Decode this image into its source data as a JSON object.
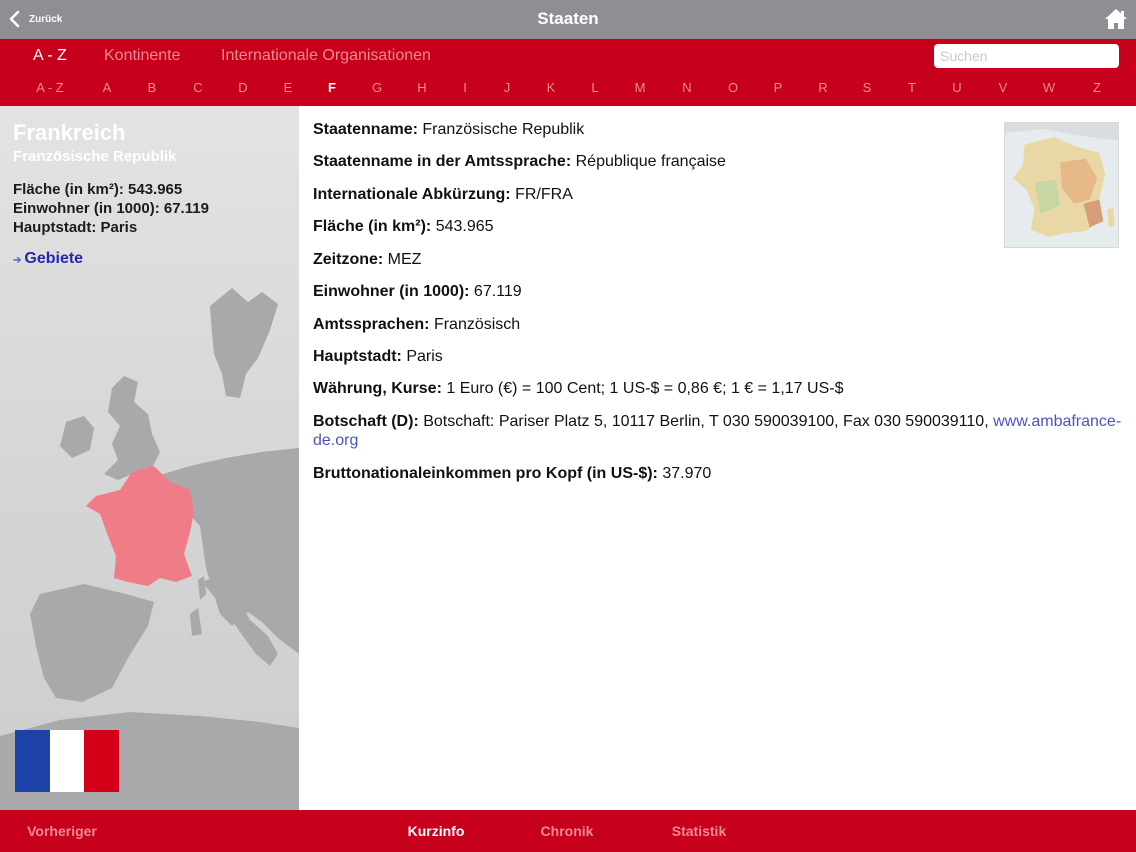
{
  "titlebar": {
    "back_label": "Zurück",
    "title": "Staaten"
  },
  "nav": {
    "segments": [
      "A - Z",
      "Kontinente",
      "Internationale Organisationen"
    ],
    "active_segment": "A - Z",
    "search_placeholder": "Suchen",
    "letters": [
      "A - Z",
      "A",
      "B",
      "C",
      "D",
      "E",
      "F",
      "G",
      "H",
      "I",
      "J",
      "K",
      "L",
      "M",
      "N",
      "O",
      "P",
      "R",
      "S",
      "T",
      "U",
      "V",
      "W",
      "Z"
    ],
    "active_letter": "F"
  },
  "sidebar": {
    "country": "Frankreich",
    "official_name": "Französische Republik",
    "facts": [
      "Fläche (in km²): 543.965",
      "Einwohner (in 1000): 67.119",
      "Hauptstadt: Paris"
    ],
    "link": "Gebiete",
    "flag_colors": [
      "#1d42a8",
      "#ffffff",
      "#d4001a"
    ]
  },
  "details": [
    {
      "label": "Staatenname:",
      "value": "Französische Republik"
    },
    {
      "label": "Staatenname in der Amtssprache:",
      "value": "République française"
    },
    {
      "label": "Internationale Abkürzung:",
      "value": "FR/FRA"
    },
    {
      "label": "Fläche (in km²):",
      "value": "543.965"
    },
    {
      "label": "Zeitzone:",
      "value": "MEZ"
    },
    {
      "label": "Einwohner (in 1000):",
      "value": "67.119"
    },
    {
      "label": "Amtssprachen:",
      "value": "Französisch"
    },
    {
      "label": "Hauptstadt:",
      "value": "Paris"
    },
    {
      "label": "Währung, Kurse:",
      "value": "1 Euro (€) = 100 Cent; 1 US-$ = 0,86 €; 1 € = 1,17 US-$"
    },
    {
      "label": "Botschaft (D):",
      "value": "Botschaft: Pariser Platz 5, 10117 Berlin, T 030 590039100, Fax 030 590039110,",
      "link": "www.ambafrance-de.org"
    },
    {
      "label": "Bruttonationaleinkommen pro Kopf (in US-$):",
      "value": "37.970"
    }
  ],
  "bottom_tabs": {
    "prev": "Vorheriger",
    "tabs": [
      "Kurzinfo",
      "Chronik",
      "Statistik"
    ],
    "active_tab": "Kurzinfo"
  },
  "colors": {
    "brand_red": "#c7001c",
    "titlebar_gray": "#8e8e93",
    "highlight_country": "#f07c87",
    "link_blue": "#4a52c8"
  },
  "icons": {
    "back": "chevron-left-icon",
    "home": "home-icon",
    "link_arrow": "arrow-right-icon"
  }
}
